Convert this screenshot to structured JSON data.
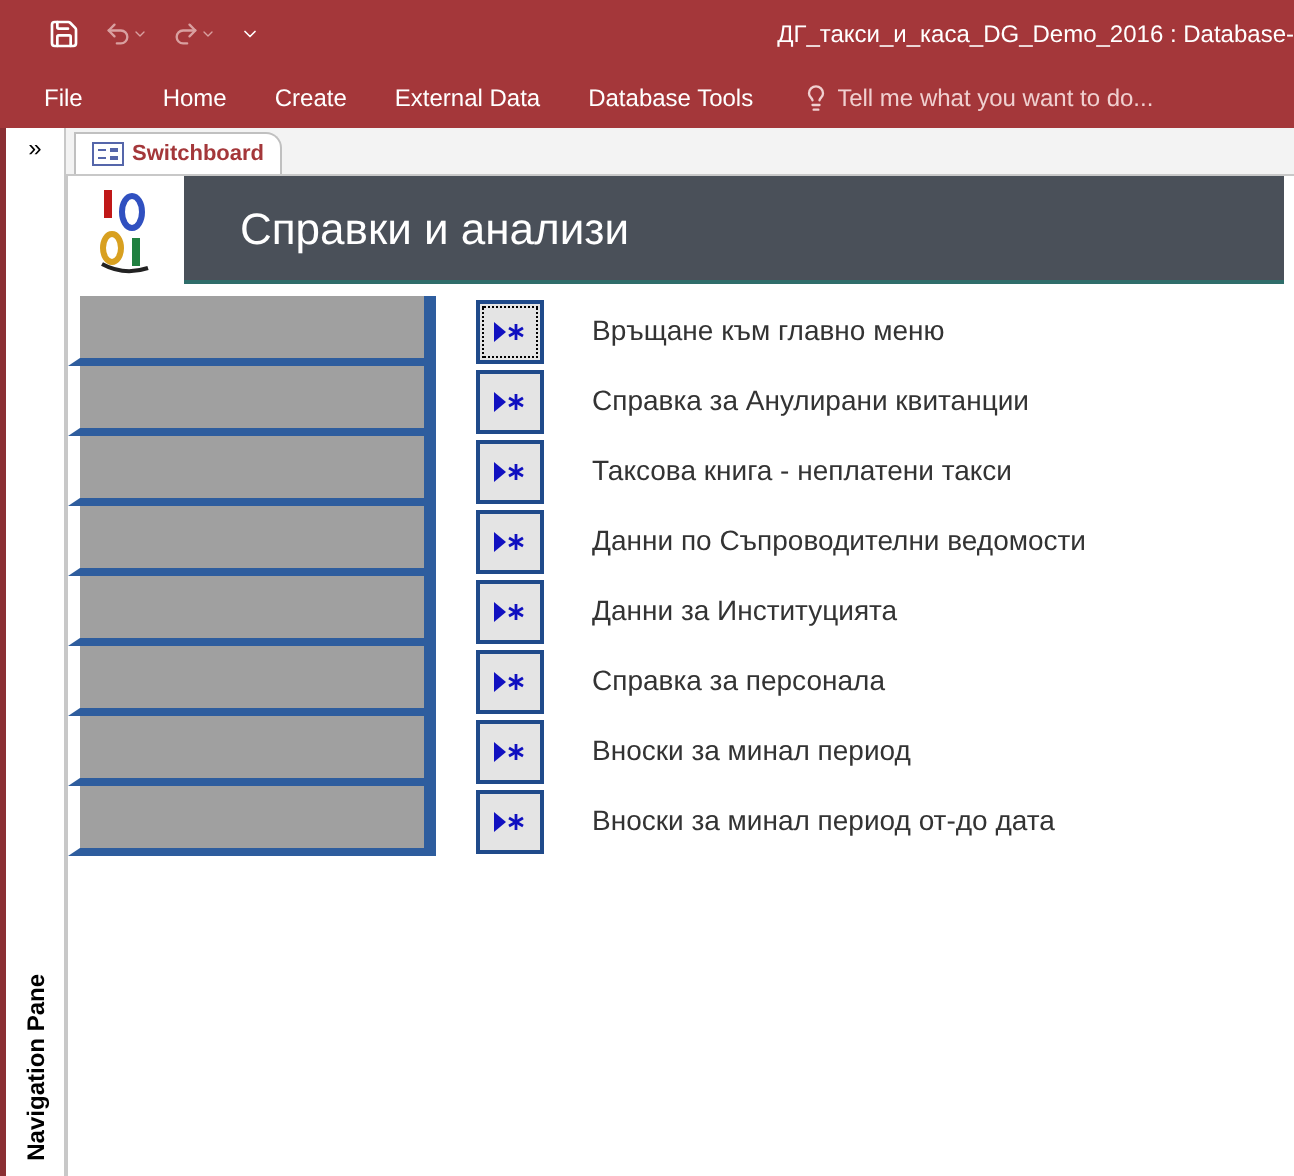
{
  "window": {
    "title": "ДГ_такси_и_каса_DG_Demo_2016 : Database- "
  },
  "ribbon_tabs": [
    {
      "label": "File"
    },
    {
      "label": "Home"
    },
    {
      "label": "Create"
    },
    {
      "label": "External Data"
    },
    {
      "label": "Database Tools"
    }
  ],
  "tell_me": {
    "placeholder": "Tell me what you want to do..."
  },
  "navigation_pane": {
    "toggle": "»",
    "label": "Navigation Pane"
  },
  "document_tabs": [
    {
      "label": "Switchboard",
      "selected": true
    }
  ],
  "form": {
    "title": "Справки и анализи",
    "items": [
      {
        "label": "Връщане към главно меню",
        "focused": true
      },
      {
        "label": "Справка за Анулирани квитанции",
        "focused": false
      },
      {
        "label": "Таксова книга - неплатени такси",
        "focused": false
      },
      {
        "label": "Данни по Съпроводителни ведомости",
        "focused": false
      },
      {
        "label": "Данни за Институцията",
        "focused": false
      },
      {
        "label": "Справка за персонала",
        "focused": false
      },
      {
        "label": "Вноски за минал период",
        "focused": false
      },
      {
        "label": "Вноски за минал период от-до дата",
        "focused": false
      }
    ]
  }
}
